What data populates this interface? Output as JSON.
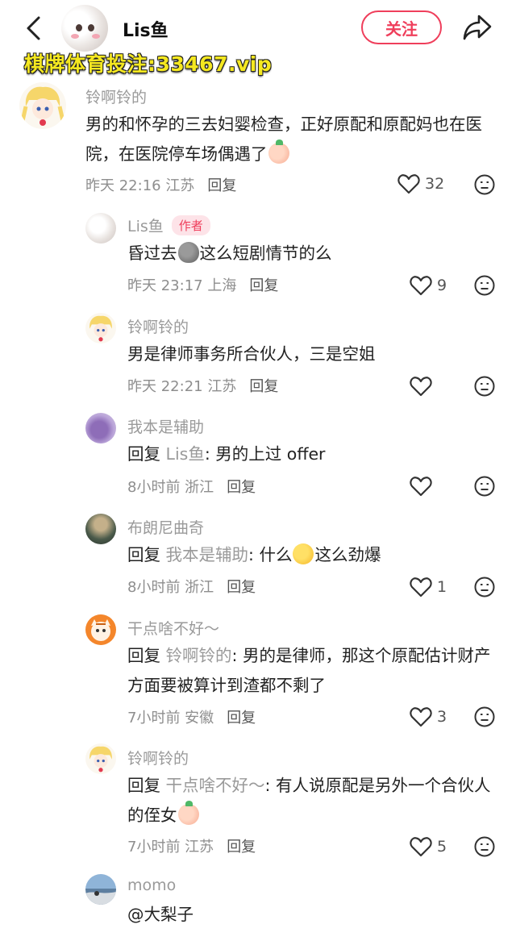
{
  "header": {
    "title": "Lis鱼",
    "follow_label": "关注",
    "watermark": "棋牌体育投注:33467.vip"
  },
  "comments": [
    {
      "name": "铃啊铃的",
      "text": "男的和怀孕的三去妇婴检查，正好原配和原配妈也在医院，在医院停车场偶遇了",
      "emoji": "peach-face-emoji",
      "time": "昨天 22:16 江苏",
      "reply_label": "回复",
      "likes": "32"
    },
    {
      "name": "Lis鱼",
      "badge": "作者",
      "text_pre": "昏过去",
      "emoji": "grey-face-emoji",
      "text_post": "这么短剧情节的么",
      "time": "昨天 23:17 上海",
      "reply_label": "回复",
      "likes": "9"
    },
    {
      "name": "铃啊铃的",
      "text": "男是律师事务所合伙人，三是空姐",
      "time": "昨天 22:21 江苏",
      "reply_label": "回复",
      "likes": ""
    },
    {
      "name": "我本是辅助",
      "reply_prefix": "回复",
      "reply_to": "Lis鱼",
      "text": ": 男的上过 offer",
      "time": "8小时前 浙江",
      "reply_label": "回复",
      "likes": ""
    },
    {
      "name": "布朗尼曲奇",
      "reply_prefix": "回复",
      "reply_to": "我本是辅助",
      "text_pre": ": 什么",
      "emoji": "wow-face-emoji",
      "text_post": "这么劲爆",
      "time": "8小时前 浙江",
      "reply_label": "回复",
      "likes": "1"
    },
    {
      "name": "干点啥不好～",
      "reply_prefix": "回复",
      "reply_to": "铃啊铃的",
      "text": ": 男的是律师，那这个原配估计财产方面要被算计到渣都不剩了",
      "time": "7小时前 安徽",
      "reply_label": "回复",
      "likes": "3"
    },
    {
      "name": "铃啊铃的",
      "reply_prefix": "回复",
      "reply_to": "干点啥不好～",
      "text": ": 有人说原配是另外一个合伙人的侄女",
      "emoji": "peach-face-emoji",
      "time": "7小时前 江苏",
      "reply_label": "回复",
      "likes": "5"
    },
    {
      "name": "momo",
      "text": "@大梨子"
    }
  ],
  "colors": {
    "accent": "#ef3e5b",
    "watermark": "#f5e820",
    "muted_text": "#9a9a9a"
  },
  "icons": [
    "back-arrow-icon",
    "share-icon",
    "heart-icon",
    "dislike-face-icon"
  ]
}
